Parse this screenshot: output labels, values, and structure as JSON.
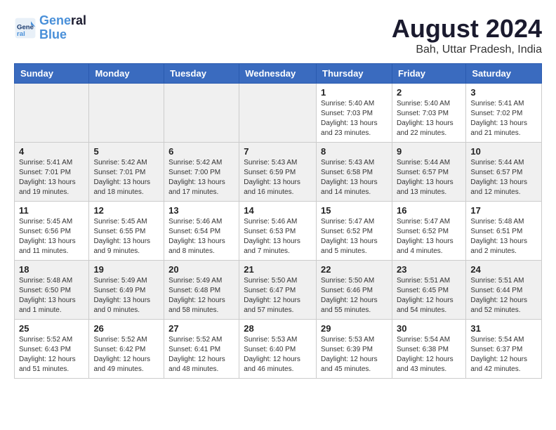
{
  "logo": {
    "line1": "General",
    "line2": "Blue"
  },
  "title": "August 2024",
  "subtitle": "Bah, Uttar Pradesh, India",
  "weekdays": [
    "Sunday",
    "Monday",
    "Tuesday",
    "Wednesday",
    "Thursday",
    "Friday",
    "Saturday"
  ],
  "weeks": [
    [
      {
        "day": "",
        "info": ""
      },
      {
        "day": "",
        "info": ""
      },
      {
        "day": "",
        "info": ""
      },
      {
        "day": "",
        "info": ""
      },
      {
        "day": "1",
        "info": "Sunrise: 5:40 AM\nSunset: 7:03 PM\nDaylight: 13 hours\nand 23 minutes."
      },
      {
        "day": "2",
        "info": "Sunrise: 5:40 AM\nSunset: 7:03 PM\nDaylight: 13 hours\nand 22 minutes."
      },
      {
        "day": "3",
        "info": "Sunrise: 5:41 AM\nSunset: 7:02 PM\nDaylight: 13 hours\nand 21 minutes."
      }
    ],
    [
      {
        "day": "4",
        "info": "Sunrise: 5:41 AM\nSunset: 7:01 PM\nDaylight: 13 hours\nand 19 minutes."
      },
      {
        "day": "5",
        "info": "Sunrise: 5:42 AM\nSunset: 7:01 PM\nDaylight: 13 hours\nand 18 minutes."
      },
      {
        "day": "6",
        "info": "Sunrise: 5:42 AM\nSunset: 7:00 PM\nDaylight: 13 hours\nand 17 minutes."
      },
      {
        "day": "7",
        "info": "Sunrise: 5:43 AM\nSunset: 6:59 PM\nDaylight: 13 hours\nand 16 minutes."
      },
      {
        "day": "8",
        "info": "Sunrise: 5:43 AM\nSunset: 6:58 PM\nDaylight: 13 hours\nand 14 minutes."
      },
      {
        "day": "9",
        "info": "Sunrise: 5:44 AM\nSunset: 6:57 PM\nDaylight: 13 hours\nand 13 minutes."
      },
      {
        "day": "10",
        "info": "Sunrise: 5:44 AM\nSunset: 6:57 PM\nDaylight: 13 hours\nand 12 minutes."
      }
    ],
    [
      {
        "day": "11",
        "info": "Sunrise: 5:45 AM\nSunset: 6:56 PM\nDaylight: 13 hours\nand 11 minutes."
      },
      {
        "day": "12",
        "info": "Sunrise: 5:45 AM\nSunset: 6:55 PM\nDaylight: 13 hours\nand 9 minutes."
      },
      {
        "day": "13",
        "info": "Sunrise: 5:46 AM\nSunset: 6:54 PM\nDaylight: 13 hours\nand 8 minutes."
      },
      {
        "day": "14",
        "info": "Sunrise: 5:46 AM\nSunset: 6:53 PM\nDaylight: 13 hours\nand 7 minutes."
      },
      {
        "day": "15",
        "info": "Sunrise: 5:47 AM\nSunset: 6:52 PM\nDaylight: 13 hours\nand 5 minutes."
      },
      {
        "day": "16",
        "info": "Sunrise: 5:47 AM\nSunset: 6:52 PM\nDaylight: 13 hours\nand 4 minutes."
      },
      {
        "day": "17",
        "info": "Sunrise: 5:48 AM\nSunset: 6:51 PM\nDaylight: 13 hours\nand 2 minutes."
      }
    ],
    [
      {
        "day": "18",
        "info": "Sunrise: 5:48 AM\nSunset: 6:50 PM\nDaylight: 13 hours\nand 1 minute."
      },
      {
        "day": "19",
        "info": "Sunrise: 5:49 AM\nSunset: 6:49 PM\nDaylight: 13 hours\nand 0 minutes."
      },
      {
        "day": "20",
        "info": "Sunrise: 5:49 AM\nSunset: 6:48 PM\nDaylight: 12 hours\nand 58 minutes."
      },
      {
        "day": "21",
        "info": "Sunrise: 5:50 AM\nSunset: 6:47 PM\nDaylight: 12 hours\nand 57 minutes."
      },
      {
        "day": "22",
        "info": "Sunrise: 5:50 AM\nSunset: 6:46 PM\nDaylight: 12 hours\nand 55 minutes."
      },
      {
        "day": "23",
        "info": "Sunrise: 5:51 AM\nSunset: 6:45 PM\nDaylight: 12 hours\nand 54 minutes."
      },
      {
        "day": "24",
        "info": "Sunrise: 5:51 AM\nSunset: 6:44 PM\nDaylight: 12 hours\nand 52 minutes."
      }
    ],
    [
      {
        "day": "25",
        "info": "Sunrise: 5:52 AM\nSunset: 6:43 PM\nDaylight: 12 hours\nand 51 minutes."
      },
      {
        "day": "26",
        "info": "Sunrise: 5:52 AM\nSunset: 6:42 PM\nDaylight: 12 hours\nand 49 minutes."
      },
      {
        "day": "27",
        "info": "Sunrise: 5:52 AM\nSunset: 6:41 PM\nDaylight: 12 hours\nand 48 minutes."
      },
      {
        "day": "28",
        "info": "Sunrise: 5:53 AM\nSunset: 6:40 PM\nDaylight: 12 hours\nand 46 minutes."
      },
      {
        "day": "29",
        "info": "Sunrise: 5:53 AM\nSunset: 6:39 PM\nDaylight: 12 hours\nand 45 minutes."
      },
      {
        "day": "30",
        "info": "Sunrise: 5:54 AM\nSunset: 6:38 PM\nDaylight: 12 hours\nand 43 minutes."
      },
      {
        "day": "31",
        "info": "Sunrise: 5:54 AM\nSunset: 6:37 PM\nDaylight: 12 hours\nand 42 minutes."
      }
    ]
  ]
}
